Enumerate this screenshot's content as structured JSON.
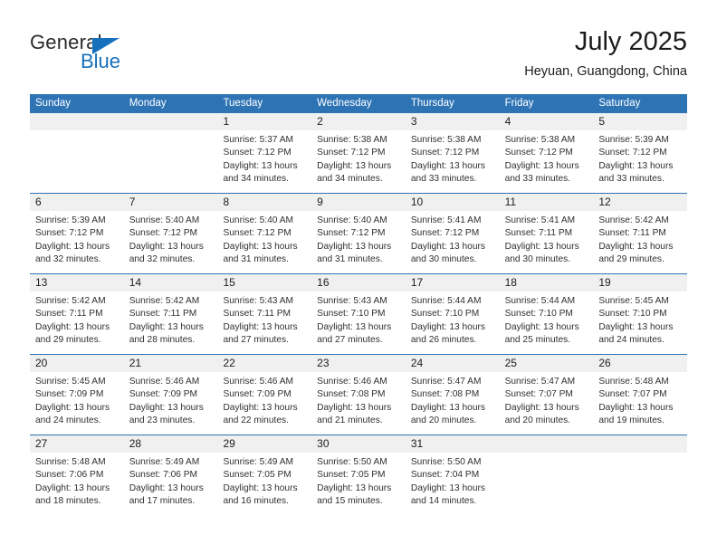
{
  "brand": {
    "name_part1": "General",
    "name_part2": "Blue",
    "triangle_color": "#1670bb"
  },
  "header": {
    "title": "July 2025",
    "subtitle": "Heyuan, Guangdong, China"
  },
  "colors": {
    "header_blue": "#2e74b5",
    "daynum_band": "#f0f0f0",
    "text": "#303030"
  },
  "calendar": {
    "weekday_headers": [
      "Sunday",
      "Monday",
      "Tuesday",
      "Wednesday",
      "Thursday",
      "Friday",
      "Saturday"
    ],
    "weeks": [
      [
        {
          "day": "",
          "sunrise": "",
          "sunset": "",
          "daylight_line1": "",
          "daylight_line2": ""
        },
        {
          "day": "",
          "sunrise": "",
          "sunset": "",
          "daylight_line1": "",
          "daylight_line2": ""
        },
        {
          "day": "1",
          "sunrise": "Sunrise: 5:37 AM",
          "sunset": "Sunset: 7:12 PM",
          "daylight_line1": "Daylight: 13 hours",
          "daylight_line2": "and 34 minutes."
        },
        {
          "day": "2",
          "sunrise": "Sunrise: 5:38 AM",
          "sunset": "Sunset: 7:12 PM",
          "daylight_line1": "Daylight: 13 hours",
          "daylight_line2": "and 34 minutes."
        },
        {
          "day": "3",
          "sunrise": "Sunrise: 5:38 AM",
          "sunset": "Sunset: 7:12 PM",
          "daylight_line1": "Daylight: 13 hours",
          "daylight_line2": "and 33 minutes."
        },
        {
          "day": "4",
          "sunrise": "Sunrise: 5:38 AM",
          "sunset": "Sunset: 7:12 PM",
          "daylight_line1": "Daylight: 13 hours",
          "daylight_line2": "and 33 minutes."
        },
        {
          "day": "5",
          "sunrise": "Sunrise: 5:39 AM",
          "sunset": "Sunset: 7:12 PM",
          "daylight_line1": "Daylight: 13 hours",
          "daylight_line2": "and 33 minutes."
        }
      ],
      [
        {
          "day": "6",
          "sunrise": "Sunrise: 5:39 AM",
          "sunset": "Sunset: 7:12 PM",
          "daylight_line1": "Daylight: 13 hours",
          "daylight_line2": "and 32 minutes."
        },
        {
          "day": "7",
          "sunrise": "Sunrise: 5:40 AM",
          "sunset": "Sunset: 7:12 PM",
          "daylight_line1": "Daylight: 13 hours",
          "daylight_line2": "and 32 minutes."
        },
        {
          "day": "8",
          "sunrise": "Sunrise: 5:40 AM",
          "sunset": "Sunset: 7:12 PM",
          "daylight_line1": "Daylight: 13 hours",
          "daylight_line2": "and 31 minutes."
        },
        {
          "day": "9",
          "sunrise": "Sunrise: 5:40 AM",
          "sunset": "Sunset: 7:12 PM",
          "daylight_line1": "Daylight: 13 hours",
          "daylight_line2": "and 31 minutes."
        },
        {
          "day": "10",
          "sunrise": "Sunrise: 5:41 AM",
          "sunset": "Sunset: 7:12 PM",
          "daylight_line1": "Daylight: 13 hours",
          "daylight_line2": "and 30 minutes."
        },
        {
          "day": "11",
          "sunrise": "Sunrise: 5:41 AM",
          "sunset": "Sunset: 7:11 PM",
          "daylight_line1": "Daylight: 13 hours",
          "daylight_line2": "and 30 minutes."
        },
        {
          "day": "12",
          "sunrise": "Sunrise: 5:42 AM",
          "sunset": "Sunset: 7:11 PM",
          "daylight_line1": "Daylight: 13 hours",
          "daylight_line2": "and 29 minutes."
        }
      ],
      [
        {
          "day": "13",
          "sunrise": "Sunrise: 5:42 AM",
          "sunset": "Sunset: 7:11 PM",
          "daylight_line1": "Daylight: 13 hours",
          "daylight_line2": "and 29 minutes."
        },
        {
          "day": "14",
          "sunrise": "Sunrise: 5:42 AM",
          "sunset": "Sunset: 7:11 PM",
          "daylight_line1": "Daylight: 13 hours",
          "daylight_line2": "and 28 minutes."
        },
        {
          "day": "15",
          "sunrise": "Sunrise: 5:43 AM",
          "sunset": "Sunset: 7:11 PM",
          "daylight_line1": "Daylight: 13 hours",
          "daylight_line2": "and 27 minutes."
        },
        {
          "day": "16",
          "sunrise": "Sunrise: 5:43 AM",
          "sunset": "Sunset: 7:10 PM",
          "daylight_line1": "Daylight: 13 hours",
          "daylight_line2": "and 27 minutes."
        },
        {
          "day": "17",
          "sunrise": "Sunrise: 5:44 AM",
          "sunset": "Sunset: 7:10 PM",
          "daylight_line1": "Daylight: 13 hours",
          "daylight_line2": "and 26 minutes."
        },
        {
          "day": "18",
          "sunrise": "Sunrise: 5:44 AM",
          "sunset": "Sunset: 7:10 PM",
          "daylight_line1": "Daylight: 13 hours",
          "daylight_line2": "and 25 minutes."
        },
        {
          "day": "19",
          "sunrise": "Sunrise: 5:45 AM",
          "sunset": "Sunset: 7:10 PM",
          "daylight_line1": "Daylight: 13 hours",
          "daylight_line2": "and 24 minutes."
        }
      ],
      [
        {
          "day": "20",
          "sunrise": "Sunrise: 5:45 AM",
          "sunset": "Sunset: 7:09 PM",
          "daylight_line1": "Daylight: 13 hours",
          "daylight_line2": "and 24 minutes."
        },
        {
          "day": "21",
          "sunrise": "Sunrise: 5:46 AM",
          "sunset": "Sunset: 7:09 PM",
          "daylight_line1": "Daylight: 13 hours",
          "daylight_line2": "and 23 minutes."
        },
        {
          "day": "22",
          "sunrise": "Sunrise: 5:46 AM",
          "sunset": "Sunset: 7:09 PM",
          "daylight_line1": "Daylight: 13 hours",
          "daylight_line2": "and 22 minutes."
        },
        {
          "day": "23",
          "sunrise": "Sunrise: 5:46 AM",
          "sunset": "Sunset: 7:08 PM",
          "daylight_line1": "Daylight: 13 hours",
          "daylight_line2": "and 21 minutes."
        },
        {
          "day": "24",
          "sunrise": "Sunrise: 5:47 AM",
          "sunset": "Sunset: 7:08 PM",
          "daylight_line1": "Daylight: 13 hours",
          "daylight_line2": "and 20 minutes."
        },
        {
          "day": "25",
          "sunrise": "Sunrise: 5:47 AM",
          "sunset": "Sunset: 7:07 PM",
          "daylight_line1": "Daylight: 13 hours",
          "daylight_line2": "and 20 minutes."
        },
        {
          "day": "26",
          "sunrise": "Sunrise: 5:48 AM",
          "sunset": "Sunset: 7:07 PM",
          "daylight_line1": "Daylight: 13 hours",
          "daylight_line2": "and 19 minutes."
        }
      ],
      [
        {
          "day": "27",
          "sunrise": "Sunrise: 5:48 AM",
          "sunset": "Sunset: 7:06 PM",
          "daylight_line1": "Daylight: 13 hours",
          "daylight_line2": "and 18 minutes."
        },
        {
          "day": "28",
          "sunrise": "Sunrise: 5:49 AM",
          "sunset": "Sunset: 7:06 PM",
          "daylight_line1": "Daylight: 13 hours",
          "daylight_line2": "and 17 minutes."
        },
        {
          "day": "29",
          "sunrise": "Sunrise: 5:49 AM",
          "sunset": "Sunset: 7:05 PM",
          "daylight_line1": "Daylight: 13 hours",
          "daylight_line2": "and 16 minutes."
        },
        {
          "day": "30",
          "sunrise": "Sunrise: 5:50 AM",
          "sunset": "Sunset: 7:05 PM",
          "daylight_line1": "Daylight: 13 hours",
          "daylight_line2": "and 15 minutes."
        },
        {
          "day": "31",
          "sunrise": "Sunrise: 5:50 AM",
          "sunset": "Sunset: 7:04 PM",
          "daylight_line1": "Daylight: 13 hours",
          "daylight_line2": "and 14 minutes."
        },
        {
          "day": "",
          "sunrise": "",
          "sunset": "",
          "daylight_line1": "",
          "daylight_line2": ""
        },
        {
          "day": "",
          "sunrise": "",
          "sunset": "",
          "daylight_line1": "",
          "daylight_line2": ""
        }
      ]
    ]
  }
}
